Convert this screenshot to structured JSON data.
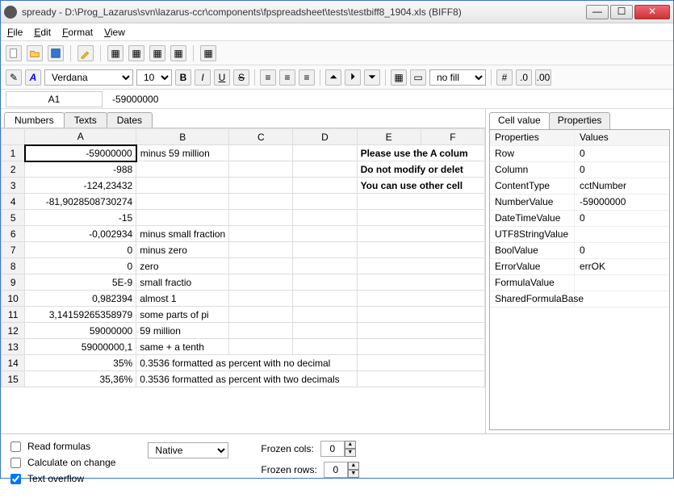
{
  "window": {
    "title": "spready - D:\\Prog_Lazarus\\svn\\lazarus-ccr\\components\\fpspreadsheet\\tests\\testbiff8_1904.xls (BIFF8)"
  },
  "menu": {
    "file": "File",
    "edit": "Edit",
    "format": "Format",
    "view": "View"
  },
  "format_toolbar": {
    "font_name": "Verdana",
    "font_size": "10",
    "fill": "no fill"
  },
  "cellref": {
    "name": "A1",
    "formula": "-59000000"
  },
  "sheet_tabs": {
    "numbers": "Numbers",
    "texts": "Texts",
    "dates": "Dates"
  },
  "columns": [
    "A",
    "B",
    "C",
    "D",
    "E",
    "F"
  ],
  "rows": [
    {
      "n": "1",
      "a": "-59000000",
      "b": "minus 59 million",
      "e": "Please use the A colum",
      "bold": true,
      "sel": true
    },
    {
      "n": "2",
      "a": "-988",
      "b": "",
      "e": "Do not modify or delet",
      "bold": true
    },
    {
      "n": "3",
      "a": "-124,23432",
      "b": "",
      "e": "You can use other cell",
      "bold": true
    },
    {
      "n": "4",
      "a": "-81,9028508730274",
      "b": "",
      "e": ""
    },
    {
      "n": "5",
      "a": "-15",
      "b": "",
      "e": ""
    },
    {
      "n": "6",
      "a": "-0,002934",
      "b": "minus small fraction",
      "e": ""
    },
    {
      "n": "7",
      "a": "0",
      "b": "minus zero",
      "e": ""
    },
    {
      "n": "8",
      "a": "0",
      "b": "zero",
      "e": ""
    },
    {
      "n": "9",
      "a": "5E-9",
      "b": "small fractio",
      "e": ""
    },
    {
      "n": "10",
      "a": "0,982394",
      "b": "almost 1",
      "e": ""
    },
    {
      "n": "11",
      "a": "3,14159265358979",
      "b": "some parts of pi",
      "e": ""
    },
    {
      "n": "12",
      "a": "59000000",
      "b": "59 million",
      "e": ""
    },
    {
      "n": "13",
      "a": "59000000,1",
      "b": "same + a tenth",
      "e": ""
    },
    {
      "n": "14",
      "a": "35%",
      "b": "0.3536 formatted as percent with no decimal",
      "e": ""
    },
    {
      "n": "15",
      "a": "35,36%",
      "b": "0.3536 formatted as percent with two decimals",
      "e": ""
    }
  ],
  "prop_tabs": {
    "cellvalue": "Cell value",
    "properties": "Properties"
  },
  "prop_header": {
    "k": "Properties",
    "v": "Values"
  },
  "props": [
    {
      "k": "Row",
      "v": "0"
    },
    {
      "k": "Column",
      "v": "0"
    },
    {
      "k": "ContentType",
      "v": "cctNumber"
    },
    {
      "k": "NumberValue",
      "v": "-59000000"
    },
    {
      "k": "DateTimeValue",
      "v": "0"
    },
    {
      "k": "UTF8StringValue",
      "v": ""
    },
    {
      "k": "BoolValue",
      "v": "0"
    },
    {
      "k": "ErrorValue",
      "v": "errOK"
    },
    {
      "k": "FormulaValue",
      "v": ""
    },
    {
      "k": "SharedFormulaBase",
      "v": ""
    }
  ],
  "footer": {
    "read_formulas": "Read formulas",
    "calc_on_change": "Calculate on change",
    "text_overflow": "Text overflow",
    "mode": "Native",
    "frozen_cols_label": "Frozen cols:",
    "frozen_rows_label": "Frozen rows:",
    "frozen_cols": "0",
    "frozen_rows": "0"
  }
}
